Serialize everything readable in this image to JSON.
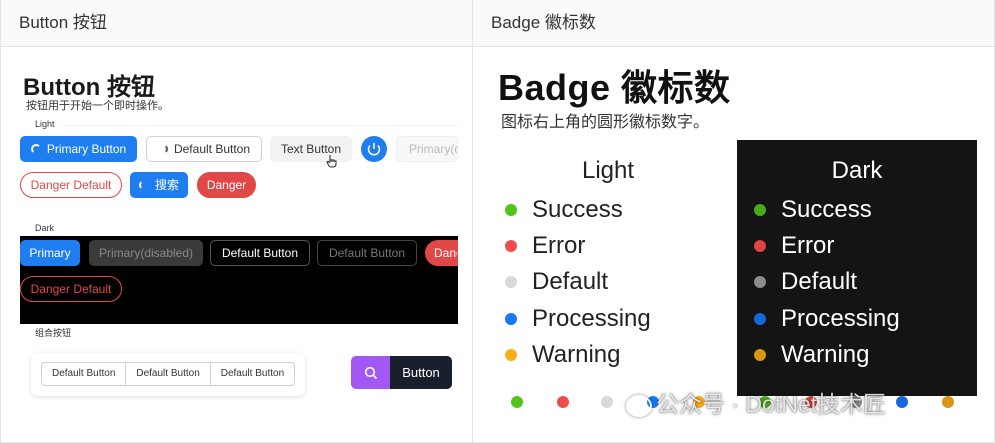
{
  "headers": {
    "left": "Button 按钮",
    "right": "Badge 徽标数"
  },
  "button_panel": {
    "title": "Button 按钮",
    "subtitle": "按钮用于开始一个即时操作。",
    "light_label": "Light",
    "dark_label": "Dark",
    "group_label": "组合按钮",
    "light_row1": {
      "primary": "Primary Button",
      "default": "Default Button",
      "text": "Text Button",
      "disabled": "Primary(disabled)"
    },
    "light_row2": {
      "danger_default": "Danger Default",
      "search": "搜索",
      "danger": "Danger"
    },
    "dark_row1": {
      "primary": "Primary",
      "disabled": "Primary(disabled)",
      "default": "Default Button",
      "default_disabled": "Default Button",
      "danger": "Danger"
    },
    "dark_row2": {
      "danger_default": "Danger Default"
    },
    "group_buttons": [
      "Default Button",
      "Default Button",
      "Default Button"
    ],
    "search_button": {
      "label": "Button",
      "icon": "search-icon"
    }
  },
  "badge_panel": {
    "title": "Badge 徽标数",
    "subtitle": "图标右上角的圆形徽标数字。",
    "light_title": "Light",
    "dark_title": "Dark",
    "statuses": [
      {
        "label": "Success",
        "color": "#52c41a"
      },
      {
        "label": "Error",
        "color": "#f14c4c"
      },
      {
        "label": "Default",
        "color": "#d9d9d9"
      },
      {
        "label": "Processing",
        "color": "#1677ff"
      },
      {
        "label": "Warning",
        "color": "#faad14"
      }
    ],
    "dark_statuses": [
      {
        "label": "Success",
        "color": "#49aa19"
      },
      {
        "label": "Error",
        "color": "#dc4446"
      },
      {
        "label": "Default",
        "color": "#8c8c8c"
      },
      {
        "label": "Processing",
        "color": "#1668dc"
      },
      {
        "label": "Warning",
        "color": "#d89614"
      }
    ]
  },
  "watermark": "公众号 · DotNet技术匠"
}
